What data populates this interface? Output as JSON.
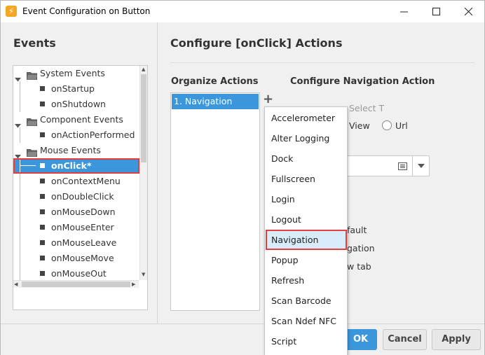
{
  "window": {
    "title": "Event Configuration on Button",
    "app_icon": "ignition-icon"
  },
  "events_panel": {
    "title": "Events",
    "search_placeholder": "",
    "tree": [
      {
        "label": "System Events",
        "type": "group",
        "expanded": true
      },
      {
        "label": "onStartup",
        "type": "event"
      },
      {
        "label": "onShutdown",
        "type": "event"
      },
      {
        "label": "Component Events",
        "type": "group",
        "expanded": true
      },
      {
        "label": "onActionPerformed",
        "type": "event"
      },
      {
        "label": "Mouse Events",
        "type": "group",
        "expanded": true
      },
      {
        "label": "onClick*",
        "type": "event",
        "selected": true
      },
      {
        "label": "onContextMenu",
        "type": "event"
      },
      {
        "label": "onDoubleClick",
        "type": "event"
      },
      {
        "label": "onMouseDown",
        "type": "event"
      },
      {
        "label": "onMouseEnter",
        "type": "event"
      },
      {
        "label": "onMouseLeave",
        "type": "event"
      },
      {
        "label": "onMouseMove",
        "type": "event"
      },
      {
        "label": "onMouseOut",
        "type": "event"
      }
    ]
  },
  "config_panel": {
    "title": "Configure [onClick] Actions",
    "organize_title": "Organize Actions",
    "navigation_title": "Configure Navigation Action",
    "actions": [
      "1. Navigation"
    ],
    "add_button": "+",
    "partial_labels": {
      "select_type": "Select T",
      "view_option": "View",
      "url_option": "Url",
      "default_text": "fault",
      "navigation_text": "gation",
      "new_tab_text": "w tab"
    }
  },
  "add_action_menu": {
    "items": [
      "Accelerometer",
      "Alter Logging",
      "Dock",
      "Fullscreen",
      "Login",
      "Logout",
      "Navigation",
      "Popup",
      "Refresh",
      "Scan Barcode",
      "Scan Ndef NFC",
      "Script"
    ],
    "highlighted": "Navigation"
  },
  "footer": {
    "ok": "OK",
    "cancel": "Cancel",
    "apply": "Apply"
  },
  "colors": {
    "accent": "#3b96dc",
    "highlight_outline": "#e53c3c",
    "menu_hover": "#d9ecfb"
  }
}
